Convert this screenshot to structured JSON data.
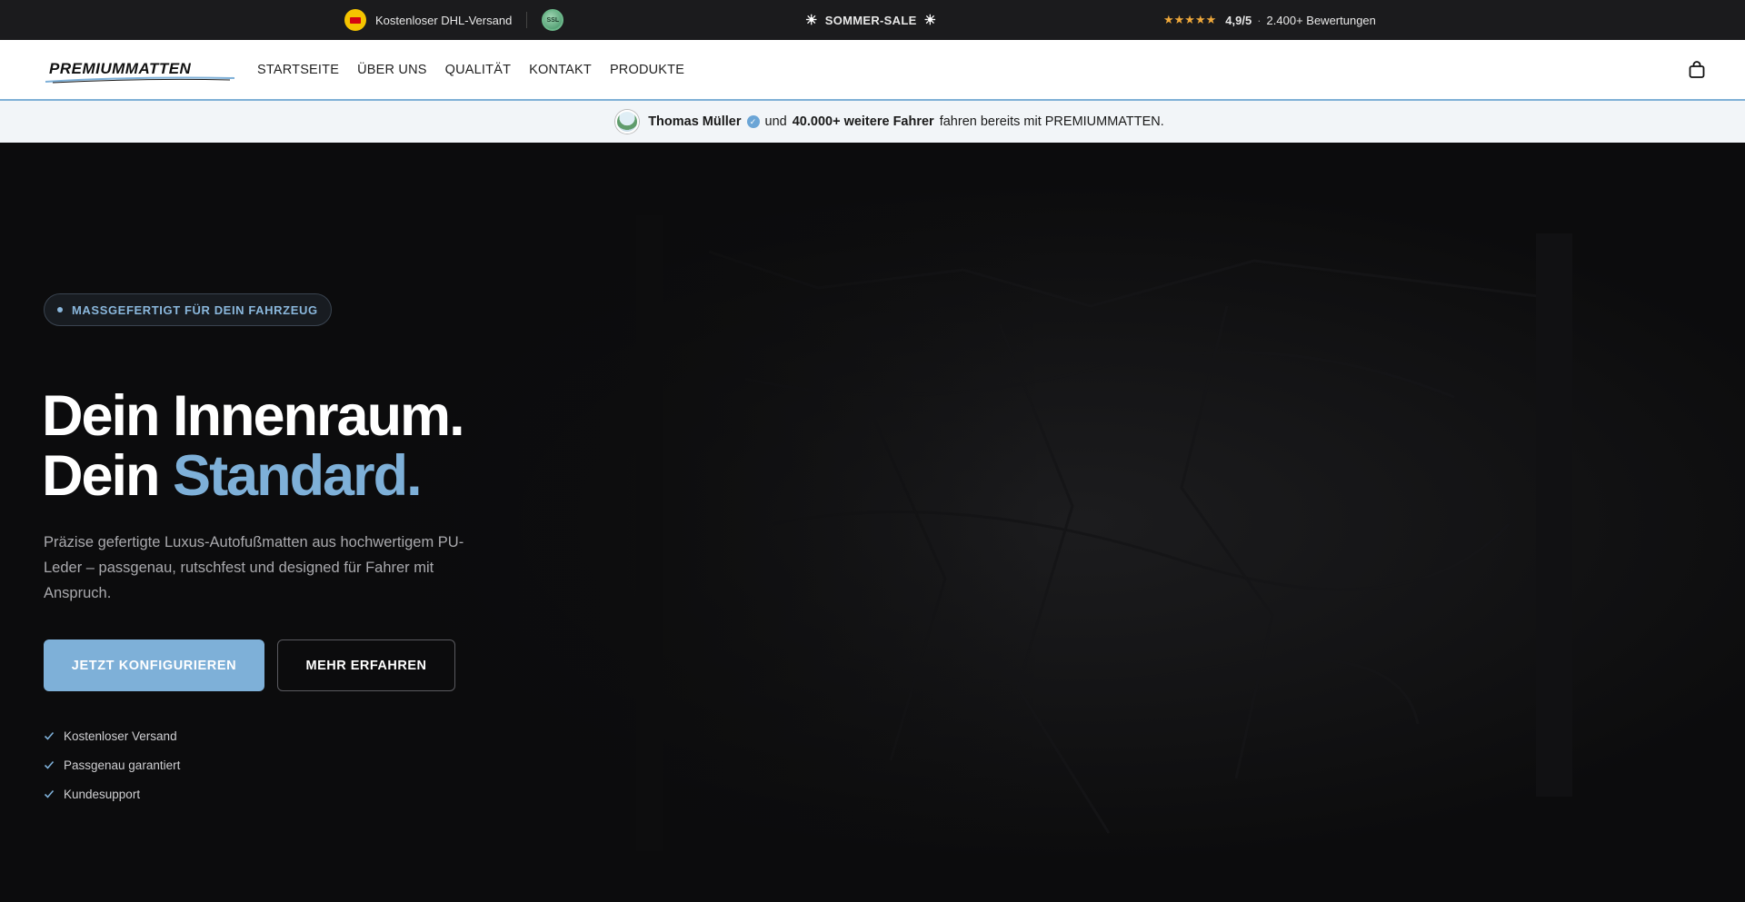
{
  "topbar": {
    "shipping_label": "Kostenloser DHL-Versand",
    "ssl_label": "SSL",
    "sale_label": "SOMMER-SALE",
    "sun_glyph": "☀",
    "stars": "★★★★★",
    "rating": "4,9/5",
    "separator": "·",
    "reviews": "2.400+ Bewertungen"
  },
  "nav": {
    "logo": "PREMIUMMATTEN",
    "items": [
      {
        "label": "STARTSEITE"
      },
      {
        "label": "ÜBER UNS"
      },
      {
        "label": "QUALITÄT"
      },
      {
        "label": "KONTAKT"
      },
      {
        "label": "PRODUKTE"
      }
    ]
  },
  "proof": {
    "name": "Thomas Müller",
    "verified_glyph": "✓",
    "connector": "und",
    "count": "40.000+ weitere Fahrer",
    "suffix": "fahren bereits mit PREMIUMMATTEN."
  },
  "hero": {
    "tag": "MASSGEFERTIGT FÜR DEIN FAHRZEUG",
    "headline_line1": "Dein Innenraum.",
    "headline_line2_prefix": "Dein",
    "headline_line2_accent": "Standard.",
    "subtitle": "Präzise gefertigte Luxus-Autofußmatten aus hochwertigem PU-Leder – passgenau, rutschfest und designed für Fahrer mit Anspruch.",
    "cta_primary": "JETZT KONFIGURIEREN",
    "cta_secondary": "MEHR ERFAHREN",
    "features": [
      {
        "label": "Kostenloser Versand"
      },
      {
        "label": "Passgenau garantiert"
      },
      {
        "label": "Kundesupport"
      }
    ]
  },
  "colors": {
    "accent": "#7eb0d8",
    "topbar_bg": "#1b1b1d",
    "hero_bg": "#0c0c0d",
    "star": "#f0a93b"
  }
}
